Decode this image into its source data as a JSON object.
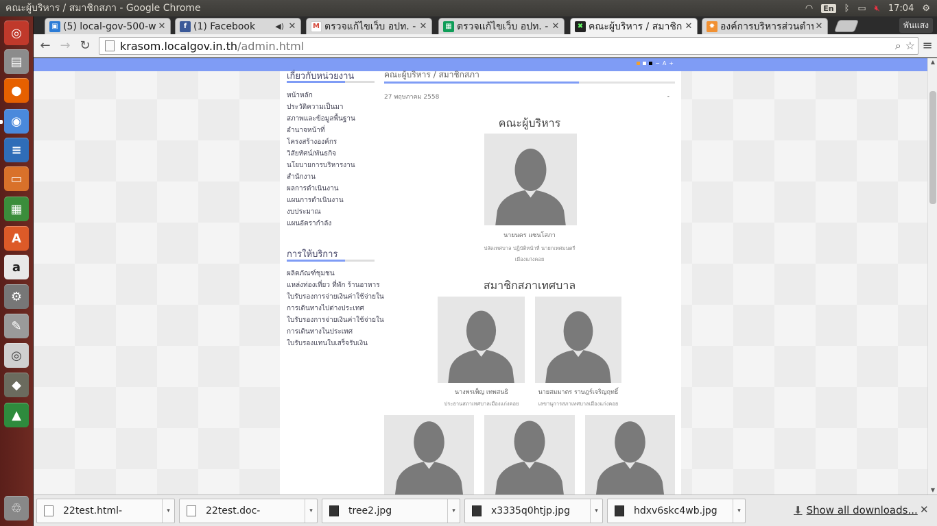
{
  "window_title": "คณะผู้บริหาร / สมาชิกสภา - Google Chrome",
  "system": {
    "lang": "En",
    "clock": "17:04"
  },
  "tabs": [
    {
      "label": "(5) local-gov-500-we",
      "icon": "trello-icon",
      "color": "#2b7bd6",
      "active": false
    },
    {
      "label": "(1) Facebook",
      "icon": "facebook-icon",
      "color": "#3b5998",
      "active": false,
      "audio": true
    },
    {
      "label": "ตรวจแก้ไขเว็บ อปท. -",
      "icon": "gmail-icon",
      "color": "#d44638",
      "active": false
    },
    {
      "label": "ตรวจแก้ไขเว็บ อปท. -",
      "icon": "sheets-icon",
      "color": "#0f9d58",
      "active": false
    },
    {
      "label": "คณะผู้บริหาร / สมาชิก",
      "icon": "site-icon",
      "color": "#222222",
      "active": true
    },
    {
      "label": "องค์การบริหารส่วนตำบ",
      "icon": "joomla-icon",
      "color": "#f19133",
      "active": false
    }
  ],
  "profile_name": "พันแสง",
  "url": {
    "host": "krasom.localgov.in.th",
    "path": "/admin.html"
  },
  "sidebar": {
    "about": {
      "title": "เกี่ยวกับหน่วยงาน",
      "items": [
        "หน้าหลัก",
        "ประวัติความเป็นมา",
        "สภาพและข้อมูลพื้นฐาน",
        "อำนาจหน้าที่",
        "โครงสร้างองค์กร",
        "วิสัยทัศน์/พันธกิจ",
        "นโยบายการบริหารงาน",
        "สำนักงาน",
        "ผลการดำเนินงาน",
        "แผนการดำเนินงาน",
        "งบประมาณ",
        "แผนอัตรากำลัง"
      ]
    },
    "services": {
      "title": "การให้บริการ",
      "items": [
        "ผลิตภัณฑ์ชุมชน",
        "แหล่งท่องเที่ยว ที่พัก ร้านอาหาร",
        "ใบรับรองการจ่ายเงินค่าใช้จ่ายใน",
        "การเดินทางไปต่างประเทศ",
        "ใบรับรองการจ่ายเงินค่าใช้จ่ายใน",
        "การเดินทางในประเทศ",
        "ใบรับรองแทนใบเสร็จรับเงิน"
      ]
    }
  },
  "content": {
    "breadcrumb": "คณะผู้บริหาร / สมาชิกสภา",
    "date": "27 พฤษภาคม 2558",
    "dot": "-",
    "executives": {
      "title": "คณะผู้บริหาร",
      "people": [
        {
          "name": "นายนคร แซนโสภา",
          "role_1": "ปลัดเทศบาล ปฏิบัติหน้าที่ นายกเทศมนตรี",
          "role_2": "เมืองแก่งคอย"
        }
      ]
    },
    "council": {
      "title": "สมาชิกสภาเทศบาล",
      "people": [
        {
          "name": "นางพรเพ็ญ เทพสนธิ",
          "role": "ประธานสภาเทศบาลเมืองแก่งคอย"
        },
        {
          "name": "นายสมมาตร ราษฎร์เจริญฤทธิ์",
          "role": "เลขานุการสภาเทศบาลเมืองแก่งคอย"
        }
      ]
    }
  },
  "downloads": [
    {
      "name": "22test.html-",
      "type": "doc"
    },
    {
      "name": "22test.doc-",
      "type": "doc"
    },
    {
      "name": "tree2.jpg",
      "type": "img"
    },
    {
      "name": "x3335q0htjp.jpg",
      "type": "img"
    },
    {
      "name": "hdxv6skc4wb.jpg",
      "type": "img"
    }
  ],
  "show_all_downloads": "Show all downloads...",
  "colors": {
    "accent_blue": "#7f9cf5",
    "launcher": "#6e2a22",
    "silhouette": "#7a7a7a",
    "photo_bg": "#e6e6e6"
  }
}
